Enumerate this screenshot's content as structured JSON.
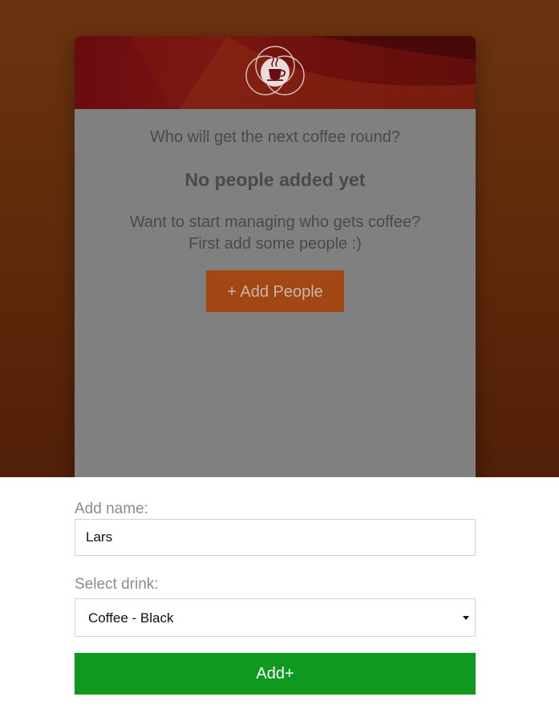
{
  "card": {
    "logo_icon": "coffee-cup-icon",
    "question": "Who will get the next coffee round?",
    "empty_title": "No people added yet",
    "empty_line1": "Want to start managing who gets coffee?",
    "empty_line2": "First add some people :)",
    "add_people_label": "+ Add People"
  },
  "form": {
    "name_label": "Add name:",
    "name_value": "Lars",
    "drink_label": "Select drink:",
    "drink_value": "Coffee - Black",
    "submit_label": "Add+"
  },
  "colors": {
    "accent": "#a34814",
    "submit": "#0f9a1f",
    "header_red": "#6a0b10"
  }
}
